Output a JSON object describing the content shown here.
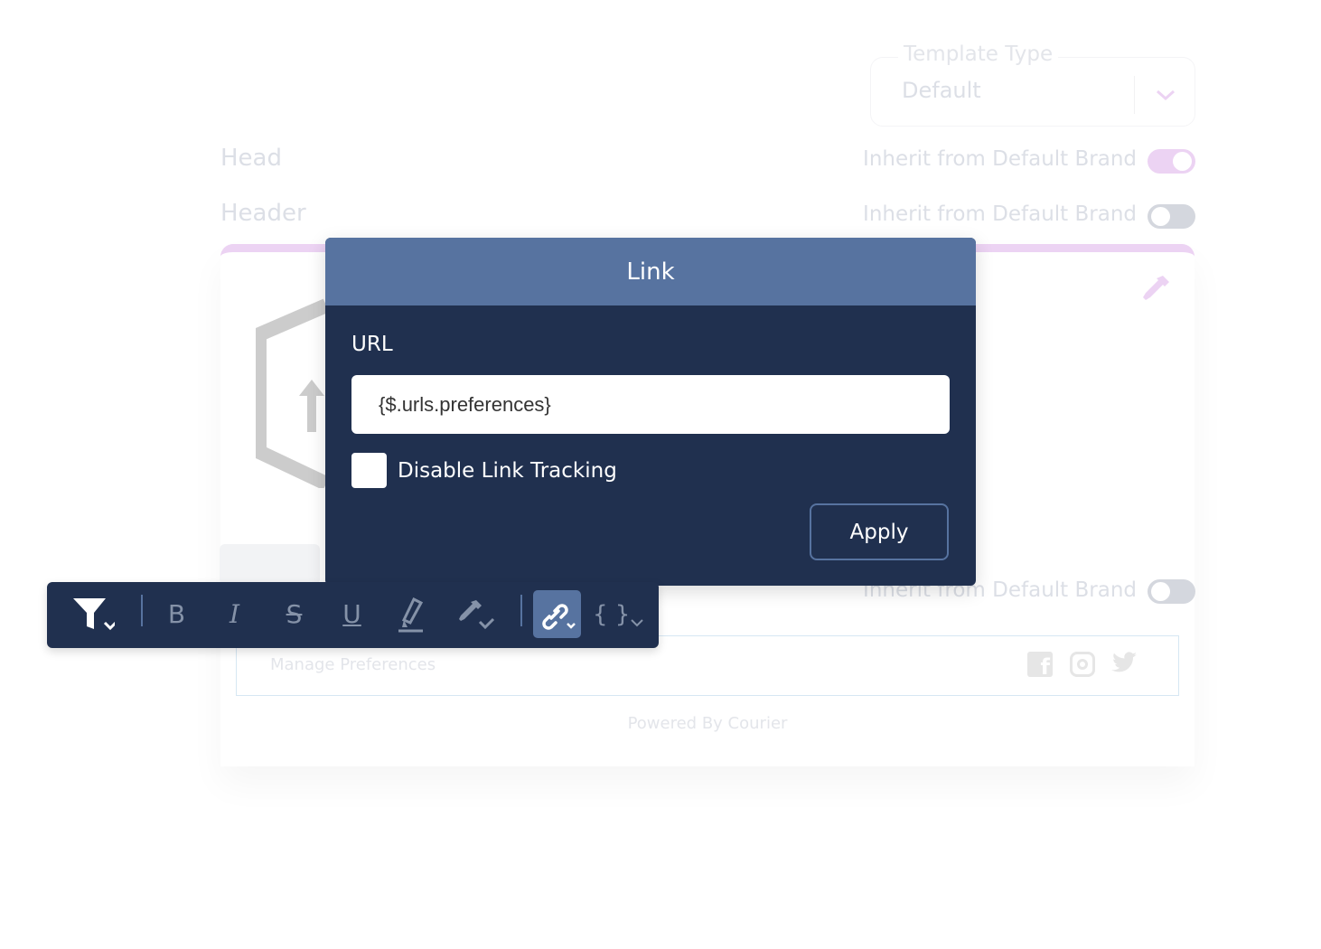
{
  "template_type": {
    "legend": "Template Type",
    "value": "Default"
  },
  "sections": [
    {
      "label": "Head",
      "inherit_label": "Inherit from Default Brand",
      "inherit_on": true
    },
    {
      "label": "Header",
      "inherit_label": "Inherit from Default Brand",
      "inherit_on": false
    }
  ],
  "footer_section": {
    "inherit_label": "Inherit from Default Brand",
    "inherit_on": false
  },
  "footer": {
    "manage_preferences": "Manage Preferences",
    "powered_by": "Powered By Courier",
    "social": [
      "facebook-icon",
      "instagram-icon",
      "twitter-icon"
    ]
  },
  "link_modal": {
    "title": "Link",
    "url_label": "URL",
    "url_value": "{$.urls.preferences}",
    "disable_tracking_label": "Disable Link Tracking",
    "disable_tracking_checked": false,
    "apply_label": "Apply"
  },
  "toolbar": {
    "items": [
      "filter-icon",
      "bold-icon",
      "italic-icon",
      "strikethrough-icon",
      "underline-icon",
      "highlighter-icon",
      "color-picker-icon",
      "link-icon",
      "variable-icon"
    ],
    "bold": "B",
    "italic": "I",
    "strike": "S",
    "underline": "U",
    "variable": "{ }",
    "active": "link-icon"
  },
  "colors": {
    "modal_header": "#5773a0",
    "modal_body": "#20304f",
    "accent_purple": "#ecd3f3",
    "toggle_off": "#d4d7de"
  }
}
